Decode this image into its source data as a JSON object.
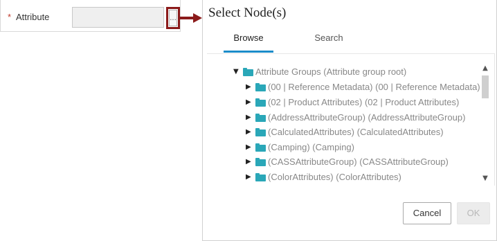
{
  "attribute_field": {
    "required_marker": "*",
    "label": "Attribute",
    "value": "",
    "browse_label": "..."
  },
  "dialog": {
    "title": "Select Node(s)",
    "tabs": [
      {
        "label": "Browse",
        "active": true
      },
      {
        "label": "Search",
        "active": false
      }
    ],
    "tree": {
      "root": {
        "label": "Attribute Groups (Attribute group root)",
        "expanded": true
      },
      "children": [
        {
          "label": "(00 | Reference Metadata) (00 | Reference Metadata)"
        },
        {
          "label": "(02 | Product Attributes) (02 | Product Attributes)"
        },
        {
          "label": "(AddressAttributeGroup) (AddressAttributeGroup)"
        },
        {
          "label": "(CalculatedAttributes) (CalculatedAttributes)"
        },
        {
          "label": "(Camping) (Camping)"
        },
        {
          "label": "(CASSAttributeGroup) (CASSAttributeGroup)"
        },
        {
          "label": "(ColorAttributes) (ColorAttributes)"
        }
      ]
    },
    "buttons": {
      "cancel": "Cancel",
      "ok": "OK"
    }
  },
  "colors": {
    "accent": "#1b8cc9",
    "highlight": "#8b1a1a",
    "folder": "#2aa7b8",
    "required": "#c0392b"
  },
  "icons": {
    "expanded": "triangle-down-icon",
    "collapsed": "triangle-right-icon",
    "folder": "folder-icon"
  }
}
